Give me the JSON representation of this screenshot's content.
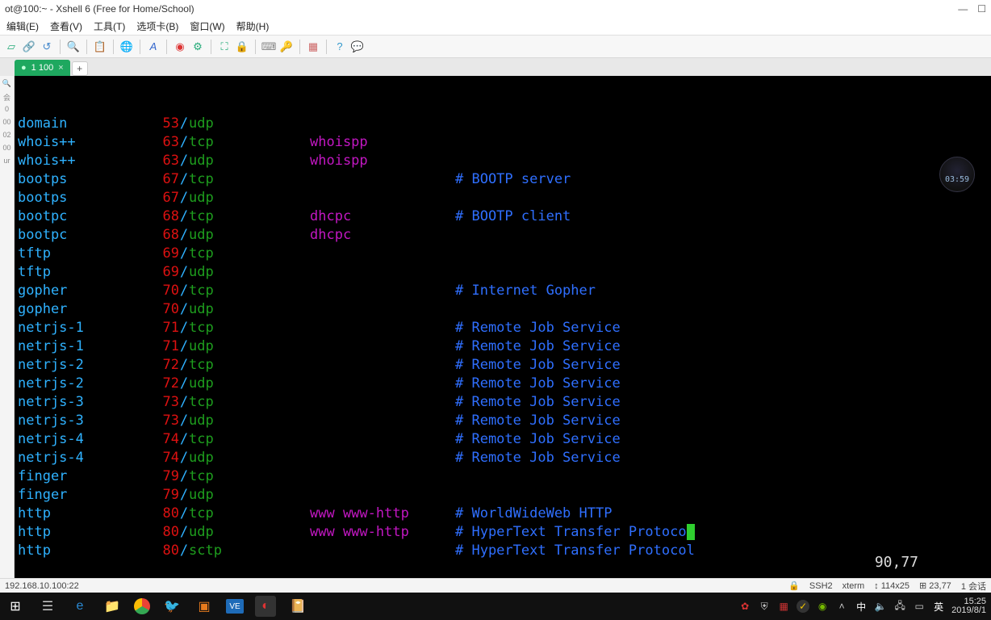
{
  "window": {
    "title": "ot@100:~ - Xshell 6 (Free for Home/School)",
    "minimize": "—",
    "maximize": "☐"
  },
  "menu": {
    "edit": "编辑(E)",
    "view": "查看(V)",
    "tools": "工具(T)",
    "tabs": "选项卡(B)",
    "window": "窗口(W)",
    "help": "帮助(H)"
  },
  "tab": {
    "label": "1 100",
    "bullet": "●",
    "close": "×",
    "add": "+"
  },
  "clock_badge": "03:59",
  "services": [
    {
      "name": "domain",
      "port": "53",
      "proto": "udp",
      "alias": "",
      "comment": ""
    },
    {
      "name": "whois++",
      "port": "63",
      "proto": "tcp",
      "alias": "whoispp",
      "comment": ""
    },
    {
      "name": "whois++",
      "port": "63",
      "proto": "udp",
      "alias": "whoispp",
      "comment": ""
    },
    {
      "name": "bootps",
      "port": "67",
      "proto": "tcp",
      "alias": "",
      "comment": "# BOOTP server"
    },
    {
      "name": "bootps",
      "port": "67",
      "proto": "udp",
      "alias": "",
      "comment": ""
    },
    {
      "name": "bootpc",
      "port": "68",
      "proto": "tcp",
      "alias": "dhcpc",
      "comment": "# BOOTP client"
    },
    {
      "name": "bootpc",
      "port": "68",
      "proto": "udp",
      "alias": "dhcpc",
      "comment": ""
    },
    {
      "name": "tftp",
      "port": "69",
      "proto": "tcp",
      "alias": "",
      "comment": ""
    },
    {
      "name": "tftp",
      "port": "69",
      "proto": "udp",
      "alias": "",
      "comment": ""
    },
    {
      "name": "gopher",
      "port": "70",
      "proto": "tcp",
      "alias": "",
      "comment": "# Internet Gopher"
    },
    {
      "name": "gopher",
      "port": "70",
      "proto": "udp",
      "alias": "",
      "comment": ""
    },
    {
      "name": "netrjs-1",
      "port": "71",
      "proto": "tcp",
      "alias": "",
      "comment": "# Remote Job Service"
    },
    {
      "name": "netrjs-1",
      "port": "71",
      "proto": "udp",
      "alias": "",
      "comment": "# Remote Job Service"
    },
    {
      "name": "netrjs-2",
      "port": "72",
      "proto": "tcp",
      "alias": "",
      "comment": "# Remote Job Service"
    },
    {
      "name": "netrjs-2",
      "port": "72",
      "proto": "udp",
      "alias": "",
      "comment": "# Remote Job Service"
    },
    {
      "name": "netrjs-3",
      "port": "73",
      "proto": "tcp",
      "alias": "",
      "comment": "# Remote Job Service"
    },
    {
      "name": "netrjs-3",
      "port": "73",
      "proto": "udp",
      "alias": "",
      "comment": "# Remote Job Service"
    },
    {
      "name": "netrjs-4",
      "port": "74",
      "proto": "tcp",
      "alias": "",
      "comment": "# Remote Job Service"
    },
    {
      "name": "netrjs-4",
      "port": "74",
      "proto": "udp",
      "alias": "",
      "comment": "# Remote Job Service"
    },
    {
      "name": "finger",
      "port": "79",
      "proto": "tcp",
      "alias": "",
      "comment": ""
    },
    {
      "name": "finger",
      "port": "79",
      "proto": "udp",
      "alias": "",
      "comment": ""
    },
    {
      "name": "http",
      "port": "80",
      "proto": "tcp",
      "alias": "www www-http",
      "comment": "# WorldWideWeb HTTP"
    },
    {
      "name": "http",
      "port": "80",
      "proto": "udp",
      "alias": "www www-http",
      "comment": "# HyperText Transfer Protoco"
    },
    {
      "name": "http",
      "port": "80",
      "proto": "sctp",
      "alias": "",
      "comment": "# HyperText Transfer Protocol"
    }
  ],
  "cursor_pos": "90,77",
  "status": {
    "address": "192.168.10.100:22",
    "proto": "SSH2",
    "termtype": "xterm",
    "winsize": "↕ 114x25",
    "cursor": "⊞ 23,77",
    "sessions": "1 会话"
  },
  "taskbar": {
    "ime_cn": "中",
    "ime_en": "英",
    "time": "15:25",
    "date": "2019/8/1"
  },
  "gutter": {
    "a": "会",
    "b": "0",
    "c": "00",
    "d": "02",
    "e": "00",
    "f": "ur"
  }
}
